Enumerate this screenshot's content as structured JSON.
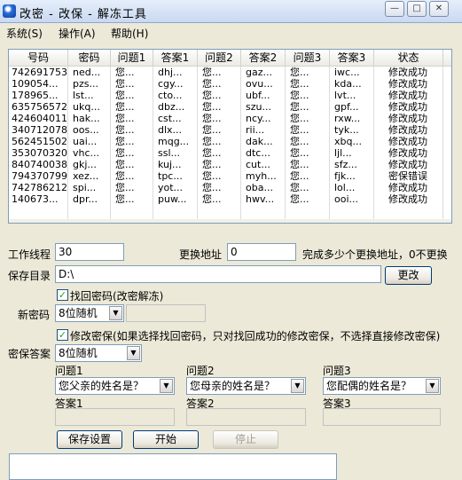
{
  "window": {
    "title": "改密 - 改保 - 解冻工具",
    "minimize_glyph": "—",
    "maximize_glyph": "□",
    "close_glyph": "✕"
  },
  "menu": [
    "系统(S)",
    "操作(A)",
    "帮助(H)"
  ],
  "table": {
    "columns": [
      "号码",
      "密码",
      "问题1",
      "答案1",
      "问题2",
      "答案2",
      "问题3",
      "答案3",
      "状态"
    ],
    "rows": [
      [
        "742691753",
        "ned...",
        "您...",
        "dhj...",
        "您...",
        "gaz...",
        "您...",
        "iwc...",
        "修改成功"
      ],
      [
        "109054...",
        "pzs...",
        "您...",
        "cgy...",
        "您...",
        "ovu...",
        "您...",
        "kda...",
        "修改成功"
      ],
      [
        "178965...",
        "lst...",
        "您...",
        "cto...",
        "您...",
        "ubf...",
        "您...",
        "lvt...",
        "修改成功"
      ],
      [
        "635756572",
        "ukq...",
        "您...",
        "dbz...",
        "您...",
        "szu...",
        "您...",
        "gpf...",
        "修改成功"
      ],
      [
        "424604011",
        "hak...",
        "您...",
        "cst...",
        "您...",
        "ncy...",
        "您...",
        "rxw...",
        "修改成功"
      ],
      [
        "340712078",
        "oos...",
        "您...",
        "dlx...",
        "您...",
        "rii...",
        "您...",
        "tyk...",
        "修改成功"
      ],
      [
        "562451502",
        "uai...",
        "您...",
        "mqg...",
        "您...",
        "dak...",
        "您...",
        "xbq...",
        "修改成功"
      ],
      [
        "353070320",
        "vhc...",
        "您...",
        "ssl...",
        "您...",
        "dtc...",
        "您...",
        "ljl...",
        "修改成功"
      ],
      [
        "840740038",
        "gkj...",
        "您...",
        "kuj...",
        "您...",
        "cut...",
        "您...",
        "sfz...",
        "修改成功"
      ],
      [
        "794370799",
        "xez...",
        "您...",
        "tpc...",
        "您...",
        "myh...",
        "您...",
        "fjk...",
        "密保错误"
      ],
      [
        "742786212",
        "spi...",
        "您...",
        "yot...",
        "您...",
        "oba...",
        "您...",
        "lol...",
        "修改成功"
      ],
      [
        "140673...",
        "dpr...",
        "您...",
        "puw...",
        "您...",
        "hwv...",
        "您...",
        "ooi...",
        "修改成功"
      ]
    ]
  },
  "form": {
    "threads_label": "工作线程",
    "threads_value": "30",
    "switch_addr_label": "更换地址",
    "switch_addr_value": "0",
    "switch_addr_hint": "完成多少个更换地址，0不更换",
    "save_dir_label": "保存目录",
    "save_dir_value": "D:\\",
    "change_button": "更改",
    "recover_pw_check": "找回密码(改密解冻)",
    "new_pw_label": "新密码",
    "new_pw_mode": "8位随机",
    "modify_sec_check": "修改密保(如果选择找回密码，只对找回成功的修改密保，不选择直接修改密保)",
    "sec_answer_label": "密保答案",
    "sec_answer_mode": "8位随机",
    "q1_label": "问题1",
    "q1_value": "您父亲的姓名是？",
    "q2_label": "问题2",
    "q2_value": "您母亲的姓名是？",
    "q3_label": "问题3",
    "q3_value": "您配偶的姓名是？",
    "a1_label": "答案1",
    "a2_label": "答案2",
    "a3_label": "答案3",
    "save_settings_button": "保存设置",
    "start_button": "开始",
    "stop_button": "停止",
    "check_glyph": "✓",
    "combo_arrow": "▼"
  }
}
